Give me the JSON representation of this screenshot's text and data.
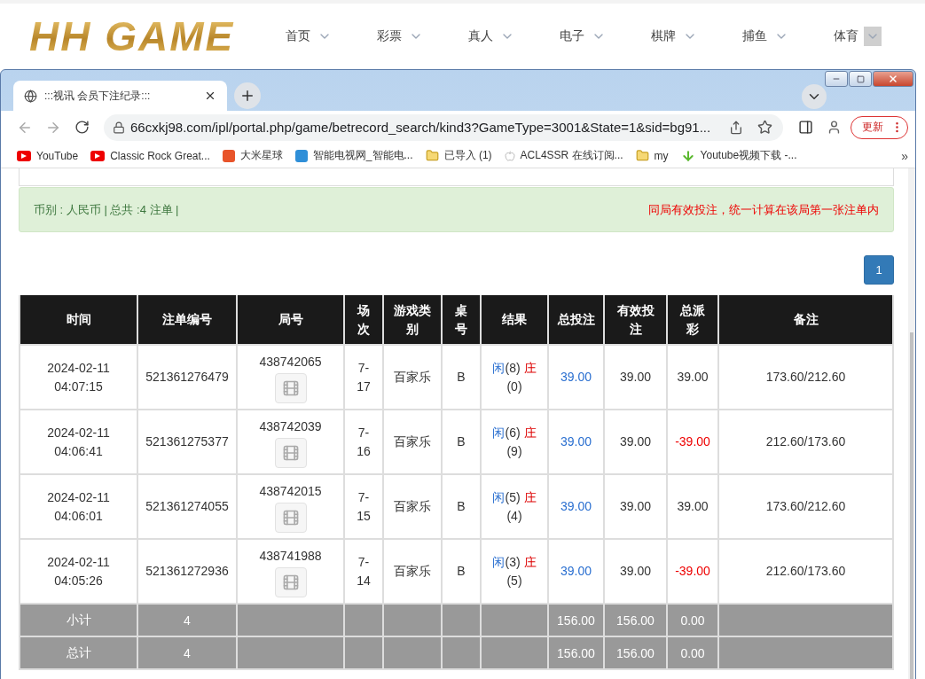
{
  "site": {
    "logo": "HH GAME",
    "nav": [
      {
        "label": "首页",
        "highlighted": false
      },
      {
        "label": "彩票",
        "highlighted": false
      },
      {
        "label": "真人",
        "highlighted": false
      },
      {
        "label": "电子",
        "highlighted": false
      },
      {
        "label": "棋牌",
        "highlighted": false
      },
      {
        "label": "捕鱼",
        "highlighted": false
      },
      {
        "label": "体育",
        "highlighted": true
      }
    ]
  },
  "browser": {
    "tabs": [
      {
        "title": ":::视讯 会员下注纪录:::",
        "selected": true
      }
    ],
    "url": "66cxkj98.com/ipl/portal.php/game/betrecord_search/kind3?GameType=3001&State=1&sid=bg91...",
    "update_button": "更新",
    "bookmarks": [
      {
        "label": "YouTube",
        "kind": "youtube"
      },
      {
        "label": "Classic Rock Great...",
        "kind": "youtube"
      },
      {
        "label": "大米星球",
        "kind": "app",
        "color": "#e8542a"
      },
      {
        "label": "智能电视网_智能电...",
        "kind": "app",
        "color": "#2f8fd8"
      },
      {
        "label": "已导入 (1)",
        "kind": "folder"
      },
      {
        "label": "ACL4SSR 在线订阅...",
        "kind": "apple"
      },
      {
        "label": "my",
        "kind": "folder"
      },
      {
        "label": "Youtube视频下载 -...",
        "kind": "download"
      }
    ],
    "more_bookmarks": "»"
  },
  "page": {
    "summary": "币别 : 人民币 | 总共 :4 注单 |",
    "notice": "同局有效投注，统一计算在该局第一张注单内",
    "pagination": [
      {
        "label": "1",
        "selected": true
      }
    ],
    "columns": [
      "时间",
      "注单编号",
      "局号",
      "场次",
      "游戏类别",
      "桌号",
      "结果",
      "总投注",
      "有效投注",
      "总派彩",
      "备注"
    ],
    "rows": [
      {
        "date": "2024-02-11",
        "time": "04:07:15",
        "order_no": "521361276479",
        "round_no": "438742065",
        "shoe": "7-17",
        "game": "百家乐",
        "table": "B",
        "result": {
          "player": "闲",
          "player_score": "(8)",
          "banker": "庄",
          "banker_score": "(0)"
        },
        "total_bet": "39.00",
        "valid_bet": "39.00",
        "payout": {
          "text": "39.00",
          "negative": false
        },
        "remark": "173.60/212.60"
      },
      {
        "date": "2024-02-11",
        "time": "04:06:41",
        "order_no": "521361275377",
        "round_no": "438742039",
        "shoe": "7-16",
        "game": "百家乐",
        "table": "B",
        "result": {
          "player": "闲",
          "player_score": "(6)",
          "banker": "庄",
          "banker_score": "(9)"
        },
        "total_bet": "39.00",
        "valid_bet": "39.00",
        "payout": {
          "text": "-39.00",
          "negative": true
        },
        "remark": "212.60/173.60"
      },
      {
        "date": "2024-02-11",
        "time": "04:06:01",
        "order_no": "521361274055",
        "round_no": "438742015",
        "shoe": "7-15",
        "game": "百家乐",
        "table": "B",
        "result": {
          "player": "闲",
          "player_score": "(5)",
          "banker": "庄",
          "banker_score": "(4)"
        },
        "total_bet": "39.00",
        "valid_bet": "39.00",
        "payout": {
          "text": "39.00",
          "negative": false
        },
        "remark": "173.60/212.60"
      },
      {
        "date": "2024-02-11",
        "time": "04:05:26",
        "order_no": "521361272936",
        "round_no": "438741988",
        "shoe": "7-14",
        "game": "百家乐",
        "table": "B",
        "result": {
          "player": "闲",
          "player_score": "(3)",
          "banker": "庄",
          "banker_score": "(5)"
        },
        "total_bet": "39.00",
        "valid_bet": "39.00",
        "payout": {
          "text": "-39.00",
          "negative": true
        },
        "remark": "212.60/173.60"
      }
    ],
    "totals": [
      {
        "label": "小计",
        "count": "4",
        "total_bet": "156.00",
        "valid_bet": "156.00",
        "payout": "0.00"
      },
      {
        "label": "总计",
        "count": "4",
        "total_bet": "156.00",
        "valid_bet": "156.00",
        "payout": "0.00"
      }
    ]
  }
}
